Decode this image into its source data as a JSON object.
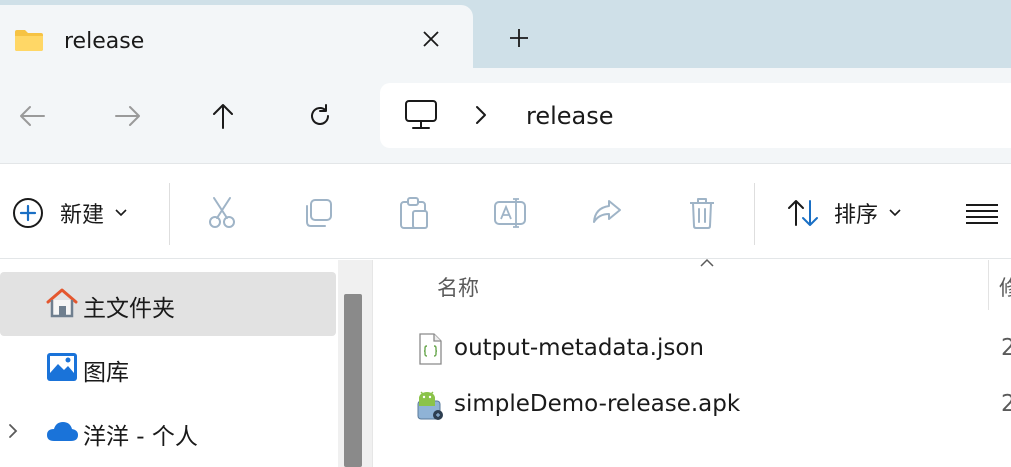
{
  "tab": {
    "title": "release",
    "close_icon": "close-icon",
    "new_tab_icon": "plus-icon"
  },
  "nav": {
    "back_icon": "arrow-left-icon",
    "forward_icon": "arrow-right-icon",
    "up_icon": "arrow-up-icon",
    "refresh_icon": "refresh-icon"
  },
  "address": {
    "root_icon": "this-pc-icon",
    "separator_icon": "chevron-right-icon",
    "path": "release"
  },
  "toolbar": {
    "new_label": "新建",
    "sort_label": "排序",
    "icons": [
      "plus-circle-icon",
      "cut-icon",
      "copy-icon",
      "paste-icon",
      "rename-icon",
      "share-icon",
      "delete-icon",
      "sort-icon",
      "view-icon"
    ]
  },
  "sidebar": {
    "items": [
      {
        "label": "主文件夹",
        "icon": "home-icon",
        "selected": true
      },
      {
        "label": "图库",
        "icon": "gallery-icon",
        "selected": false
      },
      {
        "label": "洋洋 - 个人",
        "icon": "onedrive-icon",
        "selected": false,
        "expandable": true
      }
    ]
  },
  "files": {
    "columns": [
      {
        "name": "名称"
      },
      {
        "name": "修"
      }
    ],
    "rows": [
      {
        "name": "output-metadata.json",
        "icon": "json-file-icon",
        "date": "2"
      },
      {
        "name": "simpleDemo-release.apk",
        "icon": "apk-file-icon",
        "date": "2"
      }
    ]
  },
  "colors": {
    "accent": "#1a6fc4",
    "tabstrip": "#cfe0e8",
    "chrome": "#f3f6f8",
    "selected": "#e2e2e2"
  }
}
